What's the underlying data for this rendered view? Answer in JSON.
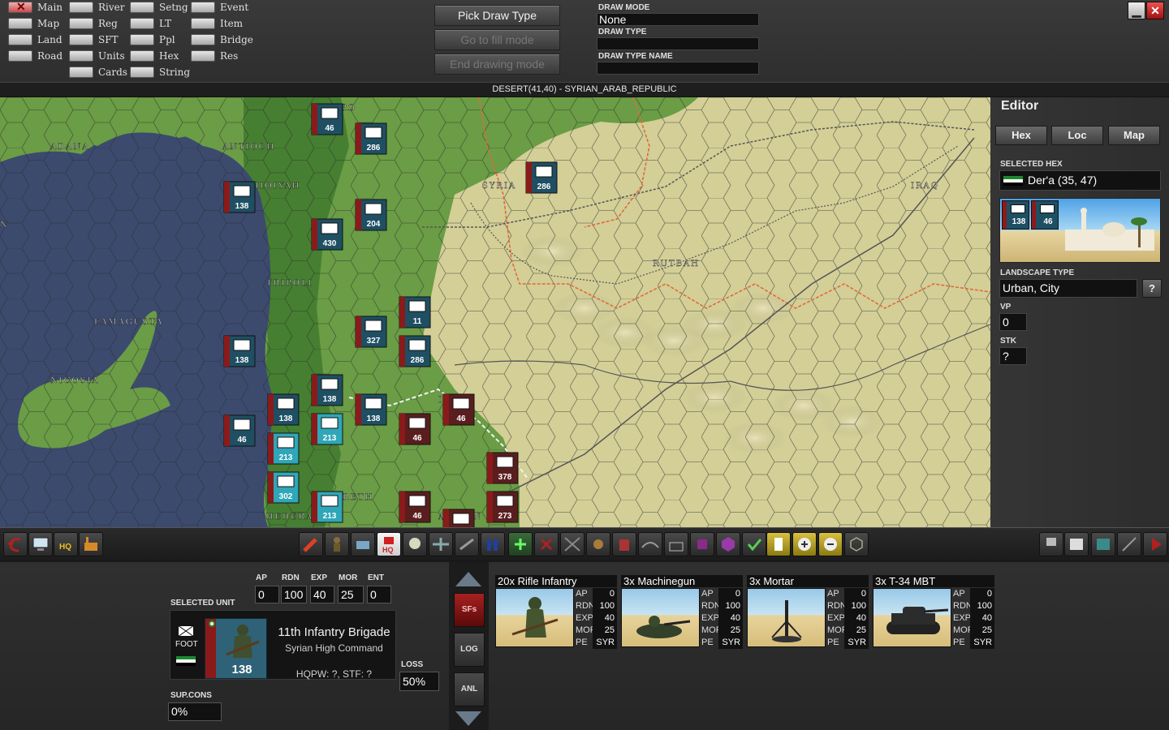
{
  "filters": {
    "col1": [
      {
        "label": "Main",
        "on": true
      },
      {
        "label": "Map",
        "on": false
      },
      {
        "label": "Land",
        "on": false
      },
      {
        "label": "Road",
        "on": false
      }
    ],
    "col2": [
      {
        "label": "River",
        "on": false
      },
      {
        "label": "Reg",
        "on": false
      },
      {
        "label": "SFT",
        "on": false
      },
      {
        "label": "Units",
        "on": false
      },
      {
        "label": "Cards",
        "on": false
      }
    ],
    "col3": [
      {
        "label": "Setng",
        "on": false
      },
      {
        "label": "LT",
        "on": false
      },
      {
        "label": "Ppl",
        "on": false
      },
      {
        "label": "Hex",
        "on": false
      },
      {
        "label": "String",
        "on": false
      }
    ],
    "col4": [
      {
        "label": "Event",
        "on": false
      },
      {
        "label": "Item",
        "on": false
      },
      {
        "label": "Bridge",
        "on": false
      },
      {
        "label": "Res",
        "on": false
      }
    ]
  },
  "draw_buttons": {
    "pick": "Pick Draw Type",
    "fill": "Go to fill mode",
    "end": "End drawing mode"
  },
  "draw_info": {
    "mode_label": "DRAW MODE",
    "mode_value": "None",
    "type_label": "DRAW TYPE",
    "type_value": "",
    "type_name_label": "DRAW TYPE NAME",
    "type_name_value": ""
  },
  "window": {
    "minimize": "▁",
    "close": "✕"
  },
  "status_line": "DESERT(41,40) - SYRIAN_ARAB_REPUBLIC",
  "map": {
    "place_names": [
      "ADANA",
      "ANTIOCH",
      "LADHIQIYAH",
      "TRIPOLI",
      "FAMAGUSTA",
      "NICOSIA",
      "SYRIA",
      "RUTBAH",
      "IRAQ",
      "IRUT",
      "HEDERA",
      "NAZARETH",
      "ALEPPO",
      "IRBID",
      "AMMAN",
      "PO",
      "N"
    ],
    "units": [
      {
        "num": "46",
        "side": "syr"
      },
      {
        "num": "286",
        "side": "syr"
      },
      {
        "num": "286",
        "side": "syr"
      },
      {
        "num": "138",
        "side": "syr"
      },
      {
        "num": "204",
        "side": "syr"
      },
      {
        "num": "430",
        "side": "syr"
      },
      {
        "num": "11",
        "side": "syr"
      },
      {
        "num": "327",
        "side": "syr"
      },
      {
        "num": "286",
        "side": "syr"
      },
      {
        "num": "138",
        "side": "syr"
      },
      {
        "num": "138",
        "side": "syr"
      },
      {
        "num": "138",
        "side": "syr"
      },
      {
        "num": "138",
        "side": "syr"
      },
      {
        "num": "46",
        "side": "syr"
      },
      {
        "num": "213",
        "side": "isr"
      },
      {
        "num": "213",
        "side": "isr"
      },
      {
        "num": "302",
        "side": "isr"
      },
      {
        "num": "213",
        "side": "isr"
      },
      {
        "num": "46",
        "side": "jor"
      },
      {
        "num": "46",
        "side": "jor"
      },
      {
        "num": "378",
        "side": "jor"
      },
      {
        "num": "46",
        "side": "jor"
      },
      {
        "num": "273",
        "side": "jor"
      },
      {
        "num": "46",
        "side": "jor"
      }
    ]
  },
  "editor": {
    "title": "Editor",
    "tabs": [
      "Hex",
      "Loc",
      "Map"
    ],
    "selected_hex_label": "SELECTED HEX",
    "selected_hex_value": "Der'a (35, 47)",
    "preview_units": [
      "138",
      "46"
    ],
    "landscape_label": "LANDSCAPE TYPE",
    "landscape_value": "Urban, City",
    "help": "?",
    "vp_label": "VP",
    "vp_value": "0",
    "stk_label": "STK",
    "stk_value": "?"
  },
  "toolbar": {
    "hq": "HQ"
  },
  "selected_unit": {
    "header": "SELECTED UNIT",
    "stat_labels": [
      "AP",
      "RDN",
      "EXP",
      "MOR",
      "ENT"
    ],
    "stat_values": [
      "0",
      "100",
      "40",
      "25",
      "0"
    ],
    "type_label": "FOOT",
    "number": "138",
    "name": "11th Infantry Brigade",
    "hq": "Syrian High Command",
    "hqpw": "HQPW: ?, STF: ?",
    "loss_label": "LOSS",
    "loss_value": "50%",
    "sup_label": "SUP.CONS",
    "sup_value": "0%"
  },
  "side_buttons": {
    "sfs": "SFs",
    "log": "LOG",
    "anl": "ANL"
  },
  "squads": [
    {
      "name": "20x Rifle Infantry",
      "stats": [
        [
          "AP",
          "0"
        ],
        [
          "RDN",
          "100"
        ],
        [
          "EXP",
          "40"
        ],
        [
          "MOR",
          "25"
        ],
        [
          "PE",
          "SYR"
        ]
      ],
      "icon": "rifleman-icon"
    },
    {
      "name": "3x Machinegun",
      "stats": [
        [
          "AP",
          "0"
        ],
        [
          "RDN",
          "100"
        ],
        [
          "EXP",
          "40"
        ],
        [
          "MOR",
          "25"
        ],
        [
          "PE",
          "SYR"
        ]
      ],
      "icon": "machinegun-icon"
    },
    {
      "name": "3x Mortar",
      "stats": [
        [
          "AP",
          "0"
        ],
        [
          "RDN",
          "100"
        ],
        [
          "EXP",
          "40"
        ],
        [
          "MOR",
          "25"
        ],
        [
          "PE",
          "SYR"
        ]
      ],
      "icon": "mortar-icon"
    },
    {
      "name": "3x T-34 MBT",
      "stats": [
        [
          "AP",
          "0"
        ],
        [
          "RDN",
          "100"
        ],
        [
          "EXP",
          "40"
        ],
        [
          "MOR",
          "25"
        ],
        [
          "PE",
          "SYR"
        ]
      ],
      "icon": "tank-icon"
    }
  ],
  "colors": {
    "sea": "#3c4a6e",
    "land_green": "#5f9540",
    "desert": "#d3cf97",
    "syr_counter": "#1f4f63",
    "isr_counter": "#2fa7b8",
    "jor_counter": "#5a1e1e",
    "bar_red": "#8b1a1a"
  }
}
